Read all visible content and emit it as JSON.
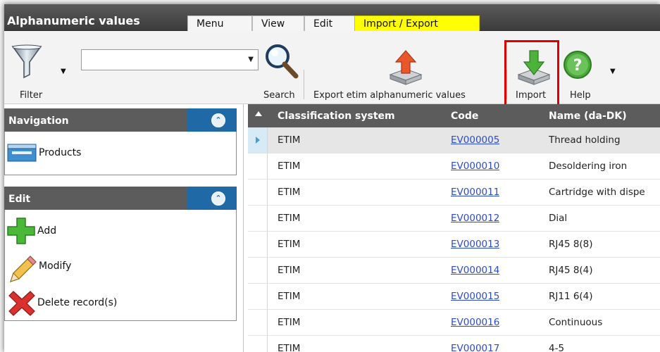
{
  "app": {
    "title": "Alphanumeric values"
  },
  "tabs": [
    {
      "label": "Menu"
    },
    {
      "label": "View"
    },
    {
      "label": "Edit"
    },
    {
      "label": "Import / Export"
    }
  ],
  "toolbar": {
    "filter_label": "Filter",
    "search_value": "",
    "search_label": "Search",
    "export_label": "Export etim alphanumeric values",
    "import_label": "Import",
    "help_label": "Help",
    "highlight_color": "#e00000",
    "active_tab_color": "#ffff00"
  },
  "navigation": {
    "title": "Navigation",
    "items": [
      {
        "label": "Products",
        "icon": "products-icon"
      }
    ]
  },
  "edit_panel": {
    "title": "Edit",
    "items": [
      {
        "label": "Add",
        "icon": "add-icon"
      },
      {
        "label": "Modify",
        "icon": "pencil-icon"
      },
      {
        "label": "Delete record(s)",
        "icon": "delete-icon"
      }
    ]
  },
  "grid": {
    "columns": [
      "Classification system",
      "Code",
      "Name (da-DK)"
    ],
    "rows": [
      {
        "system": "ETIM",
        "code": "EV000005",
        "name": "Thread holding",
        "selected": true
      },
      {
        "system": "ETIM",
        "code": "EV000010",
        "name": "Desoldering iron"
      },
      {
        "system": "ETIM",
        "code": "EV000011",
        "name": "Cartridge with dispe"
      },
      {
        "system": "ETIM",
        "code": "EV000012",
        "name": "Dial"
      },
      {
        "system": "ETIM",
        "code": "EV000013",
        "name": "RJ45 8(8)"
      },
      {
        "system": "ETIM",
        "code": "EV000014",
        "name": "RJ45 8(4)"
      },
      {
        "system": "ETIM",
        "code": "EV000015",
        "name": "RJ11 6(4)"
      },
      {
        "system": "ETIM",
        "code": "EV000016",
        "name": "Continuous"
      },
      {
        "system": "ETIM",
        "code": "EV000017",
        "name": "4-5"
      }
    ]
  }
}
